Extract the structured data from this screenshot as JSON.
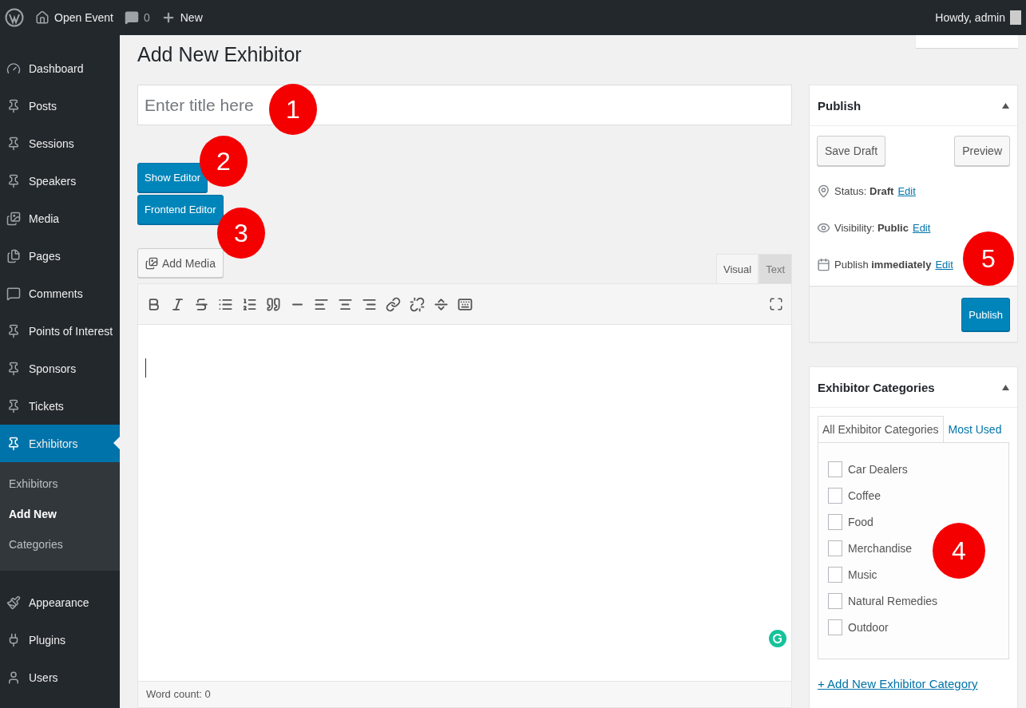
{
  "admin_bar": {
    "site_name": "Open Event",
    "comments_count": "0",
    "new_label": "New",
    "greeting": "Howdy, admin"
  },
  "sidebar": {
    "items": [
      {
        "label": "Dashboard",
        "kind": "dashboard",
        "selected": false
      },
      {
        "label": "Posts",
        "kind": "pin",
        "selected": false
      },
      {
        "label": "Sessions",
        "kind": "pin",
        "selected": false
      },
      {
        "label": "Speakers",
        "kind": "pin",
        "selected": false
      },
      {
        "label": "Media",
        "kind": "media",
        "selected": false
      },
      {
        "label": "Pages",
        "kind": "pages",
        "selected": false
      },
      {
        "label": "Comments",
        "kind": "comments",
        "selected": false
      },
      {
        "label": "Points of Interest",
        "kind": "pin",
        "selected": false
      },
      {
        "label": "Sponsors",
        "kind": "pin",
        "selected": false
      },
      {
        "label": "Tickets",
        "kind": "pin",
        "selected": false
      },
      {
        "label": "Exhibitors",
        "kind": "pin",
        "selected": true,
        "children": [
          {
            "label": "Exhibitors",
            "selected": false
          },
          {
            "label": "Add New",
            "selected": true
          },
          {
            "label": "Categories",
            "selected": false
          }
        ]
      },
      {
        "label": "Appearance",
        "kind": "appearance",
        "selected": false
      },
      {
        "label": "Plugins",
        "kind": "plugins",
        "selected": false
      },
      {
        "label": "Users",
        "kind": "users",
        "selected": false
      }
    ]
  },
  "page_title": "Add New Exhibitor",
  "title_field": {
    "placeholder": "Enter title here"
  },
  "editor_buttons": [
    "Show Editor",
    "Frontend Editor"
  ],
  "add_media": "Add Media",
  "editor_tabs": [
    {
      "label": "Visual",
      "selected": true
    },
    {
      "label": "Text",
      "selected": false
    }
  ],
  "word_count": "Word count: 0",
  "publish_box": {
    "title": "Publish",
    "expanded": true,
    "save_draft": "Save Draft",
    "preview": "Preview",
    "rows": [
      {
        "kind": "status",
        "text": "Status: **Draft**",
        "link": "Edit"
      },
      {
        "kind": "visibility",
        "text": "Visibility: **Public**",
        "link": "Edit"
      },
      {
        "kind": "schedule",
        "text": "Publish **immediately**",
        "link": "Edit"
      }
    ],
    "publish_button": "Publish"
  },
  "categories_box": {
    "title": "Exhibitor Categories",
    "expanded": true,
    "tabs": [
      {
        "label": "All Exhibitor Categories",
        "selected": true
      },
      {
        "label": "Most Used",
        "selected": false
      }
    ],
    "items": [
      {
        "label": "Car Dealers",
        "checked": false
      },
      {
        "label": "Coffee",
        "checked": false
      },
      {
        "label": "Food",
        "checked": false
      },
      {
        "label": "Merchandise",
        "checked": false
      },
      {
        "label": "Music",
        "checked": false
      },
      {
        "label": "Natural Remedies",
        "checked": false
      },
      {
        "label": "Outdoor",
        "checked": false
      }
    ],
    "add_link": "+ Add New Exhibitor Category"
  },
  "annotations": [
    "1",
    "2",
    "3",
    "4",
    "5"
  ]
}
